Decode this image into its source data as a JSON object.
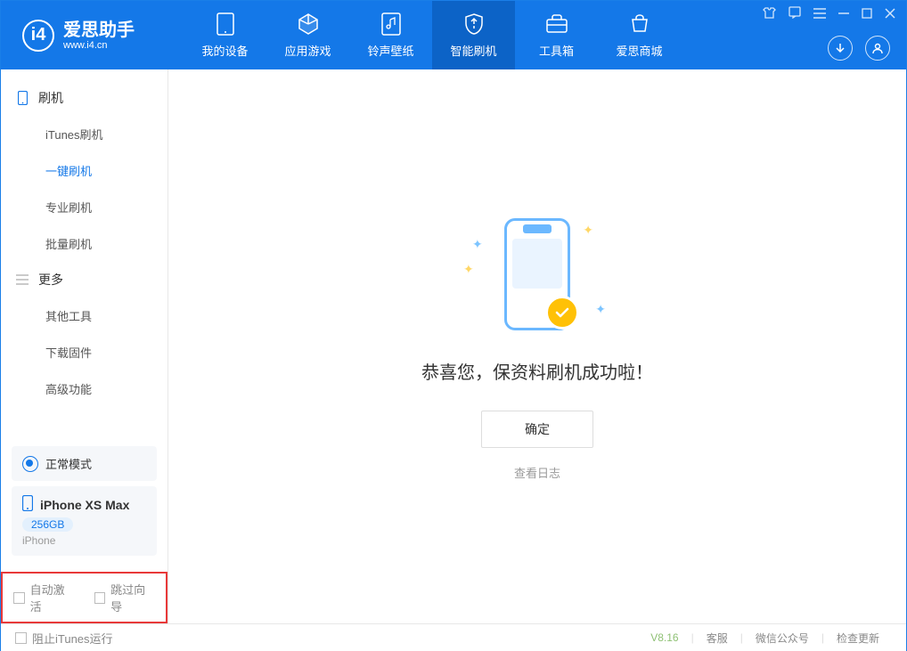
{
  "header": {
    "app_name": "爱思助手",
    "app_url": "www.i4.cn",
    "tabs": [
      {
        "label": "我的设备",
        "icon": "device-icon"
      },
      {
        "label": "应用游戏",
        "icon": "cube-icon"
      },
      {
        "label": "铃声壁纸",
        "icon": "music-icon"
      },
      {
        "label": "智能刷机",
        "icon": "shield-icon",
        "active": true
      },
      {
        "label": "工具箱",
        "icon": "toolbox-icon"
      },
      {
        "label": "爱思商城",
        "icon": "shop-icon"
      }
    ]
  },
  "sidebar": {
    "groups": [
      {
        "title": "刷机",
        "icon": "phone-icon",
        "items": [
          {
            "label": "iTunes刷机"
          },
          {
            "label": "一键刷机",
            "active": true
          },
          {
            "label": "专业刷机"
          },
          {
            "label": "批量刷机"
          }
        ]
      },
      {
        "title": "更多",
        "icon": "list-icon",
        "items": [
          {
            "label": "其他工具"
          },
          {
            "label": "下载固件"
          },
          {
            "label": "高级功能"
          }
        ]
      }
    ],
    "mode_label": "正常模式",
    "device": {
      "name": "iPhone XS Max",
      "capacity": "256GB",
      "type": "iPhone"
    },
    "options": {
      "auto_activate": "自动激活",
      "skip_guide": "跳过向导"
    }
  },
  "content": {
    "success_title": "恭喜您，保资料刷机成功啦！",
    "confirm_label": "确定",
    "log_link": "查看日志"
  },
  "footer": {
    "block_itunes": "阻止iTunes运行",
    "version": "V8.16",
    "links": [
      "客服",
      "微信公众号",
      "检查更新"
    ]
  }
}
